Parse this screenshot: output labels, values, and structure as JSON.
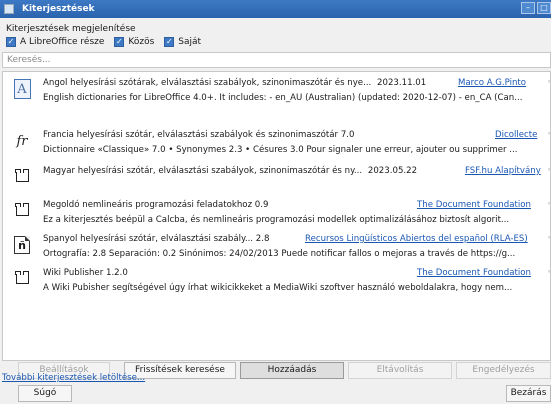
{
  "window": {
    "title": "Kiterjesztések",
    "minimize": "–",
    "maximize": "□"
  },
  "filter": {
    "label": "Kiterjesztések megjelenítése",
    "options": [
      {
        "label": "A LibreOffice része",
        "checked": true
      },
      {
        "label": "Közös",
        "checked": true
      },
      {
        "label": "Saját",
        "checked": true
      }
    ]
  },
  "search": {
    "placeholder": "Keresés..."
  },
  "extensions": [
    {
      "icon": "dictionary-A-icon",
      "name": "Angol helyesírási szótárak, elválasztási szabályok, szinonimaszótár és nye...",
      "version": "2023.11.01",
      "publisher": "Marco A.G.Pinto",
      "description": "English dictionaries for LibreOffice 4.0+.  It includes: - en_AU (Australian) (updated: 2020-12-07) - en_CA (Can..."
    },
    {
      "icon": "fr-icon",
      "name": "Francia helyesírási szótár, elválasztási szabályok és szinonimaszótár  7.0",
      "version": "",
      "publisher": "Dicollecte",
      "description": "Dictionnaire «Classique» 7.0 • Synonymes 2.3 • Césures 3.0  Pour signaler une erreur, ajouter ou supprimer ..."
    },
    {
      "icon": "puzzle-icon",
      "name": "Magyar helyesírási szótár, elválasztási szabályok, szinonimaszótár és ny...",
      "version": "2023.05.22",
      "publisher": "FSF.hu Alapítvány",
      "description": ""
    },
    {
      "icon": "puzzle-icon",
      "name": "Megoldó nemlineáris programozási feladatokhoz  0.9",
      "version": "",
      "publisher": "The Document Foundation",
      "description": "Ez a kiterjesztés beépül a Calcba, és nemlineáris programozási modellek optimalizálásához biztosít algorit..."
    },
    {
      "icon": "spanish-n-icon",
      "name": "Spanyol helyesírási szótár, elválasztási szabály...  2.8",
      "version": "",
      "publisher": "Recursos Lingüísticos Abiertos del español (RLA-ES)",
      "description": "Ortografía: 2.8 Separación: 0.2 Sinónimos: 24/02/2013  Puede notificar fallos o mejoras a través de https://g..."
    },
    {
      "icon": "puzzle-icon",
      "name": "Wiki Publisher  1.2.0",
      "version": "",
      "publisher": "The Document Foundation",
      "description": "A Wiki Pubisher segítségével úgy írhat wikicikkeket a MediaWiki szoftver használó weboldalakra, hogy nem..."
    }
  ],
  "buttons": {
    "options": "Beállítások",
    "check_updates": "Frissítések keresése",
    "add": "Hozzáadás",
    "remove": "Eltávolítás",
    "enable": "Engedélyezés"
  },
  "more_link": "További kiterjesztések letöltése...",
  "footer": {
    "help": "Súgó",
    "close": "Bezárás"
  }
}
